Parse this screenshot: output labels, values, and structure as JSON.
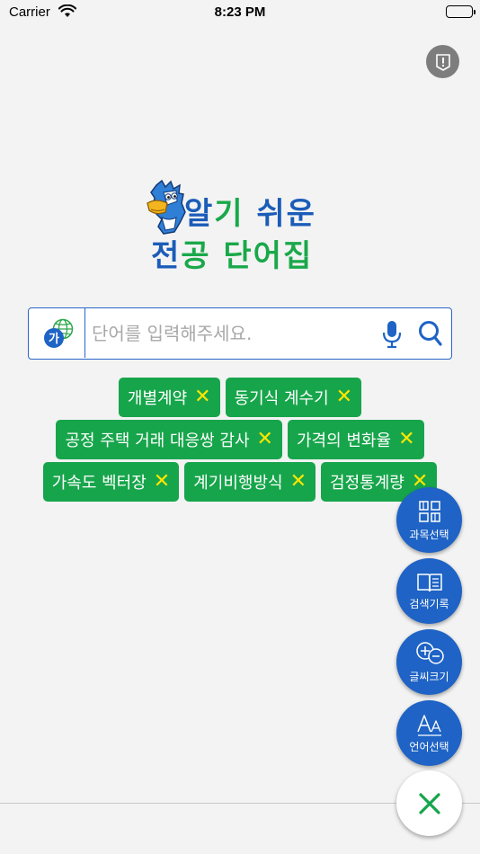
{
  "status_bar": {
    "carrier": "Carrier",
    "time": "8:23 PM"
  },
  "logo": {
    "line1_part1": "알",
    "line1_part2": "기",
    "line1_part3": " 쉬운",
    "line2_part1": "전",
    "line2_part2": "공 단어집"
  },
  "search": {
    "placeholder": "단어를 입력해주세요.",
    "value": "",
    "lang_label": "가"
  },
  "tags": [
    "개별계약",
    "동기식 계수기",
    "공정 주택 거래 대응쌍 감사",
    "가격의 변화율",
    "가속도 벡터장",
    "계기비행방식",
    "검정통계량"
  ],
  "fabs": {
    "subject": "과목선택",
    "history": "검색기록",
    "font_size": "글씨크기",
    "language": "언어선택"
  },
  "colors": {
    "accent": "#1e63c5",
    "tag_green": "#17a54b",
    "tag_x": "#ffe600"
  }
}
